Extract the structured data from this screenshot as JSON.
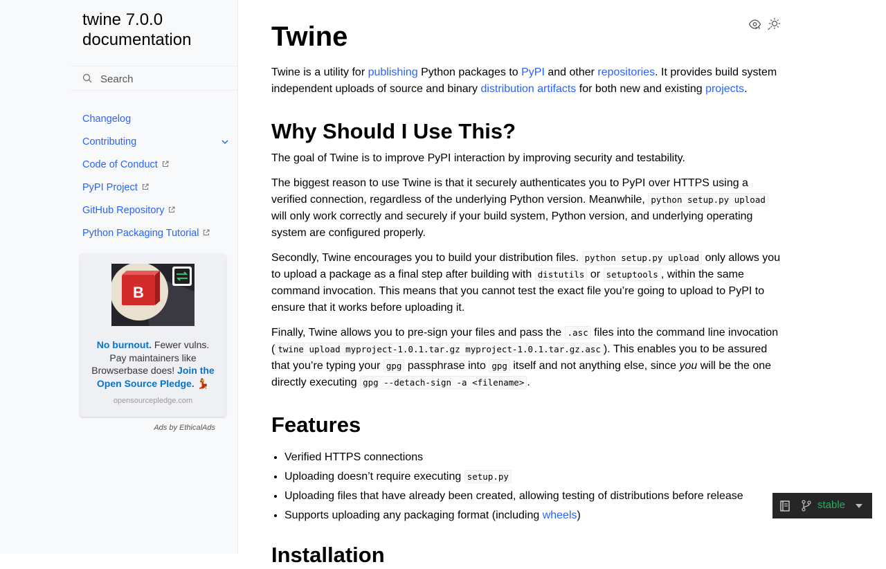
{
  "sidebar": {
    "brand_line1": "twine 7.0.0",
    "brand_line2": "documentation",
    "search_placeholder": "Search",
    "items": [
      {
        "label": "Changelog"
      },
      {
        "label": "Contributing"
      },
      {
        "label": "Code of Conduct"
      },
      {
        "label": "PyPI Project"
      },
      {
        "label": "GitHub Repository"
      },
      {
        "label": "Python Packaging Tutorial"
      }
    ],
    "ad": {
      "logo_letter": "B",
      "bold1": "No burnout.",
      "text1": " Fewer vulns. Pay maintainers like Browserbase does! ",
      "bold2": "Join the Open Source Pledge.",
      "emoji": " 💃",
      "domain": "opensourcepledge.com",
      "ads_by": "Ads by EthicalAds"
    }
  },
  "content": {
    "title": "Twine",
    "intro": {
      "t1": "Twine is a utility for ",
      "l1": "publishing",
      "t2": " Python packages to ",
      "l2": "PyPI",
      "t3": " and other ",
      "l3": "repositories",
      "t4": ". It provides build system independent uploads of source and binary ",
      "l4": "distribution artifacts",
      "t5": " for both new and existing ",
      "l5": "projects",
      "t6": "."
    },
    "h_why": "Why Should I Use This?",
    "p_goal": "The goal of Twine is to improve PyPI interaction by improving security and testability.",
    "p_reason": {
      "t1": "The biggest reason to use Twine is that it securely authenticates you to PyPI over HTTPS using a verified connection, regardless of the underlying Python version. Meanwhile, ",
      "c1": "python setup.py upload",
      "t2": " will only work correctly and securely if your build system, Python version, and underlying operating system are configured properly."
    },
    "p_second": {
      "t1": "Secondly, Twine encourages you to build your distribution files. ",
      "c1": "python setup.py upload",
      "t2": " only allows you to upload a package as a final step after building with ",
      "c2": "distutils",
      "t3": " or ",
      "c3": "setuptools",
      "t4": ", within the same command invocation. This means that you cannot test the exact file you’re going to upload to PyPI to ensure that it works before uploading it."
    },
    "p_final": {
      "t1": "Finally, Twine allows you to pre-sign your files and pass the ",
      "c1": ".asc",
      "t2": " files into the command line invocation (",
      "c2": "twine upload myproject-1.0.1.tar.gz myproject-1.0.1.tar.gz.asc",
      "t3": "). This enables you to be assured that you’re typing your ",
      "c3": "gpg",
      "t4": " passphrase into ",
      "c4": "gpg",
      "t5": " itself and not anything else, since ",
      "em": "you",
      "t6": " will be the one directly executing ",
      "c5": "gpg --detach-sign -a <filename>",
      "t7": "."
    },
    "h_features": "Features",
    "features": {
      "f1": "Verified HTTPS connections",
      "f2_text": "Uploading doesn’t require executing ",
      "f2_code": "setup.py",
      "f3": "Uploading files that have already been created, allowing testing of distributions before release",
      "f4_text": "Supports uploading any packaging format (including ",
      "f4_link": "wheels",
      "f4_end": ")"
    },
    "h_install": "Installation"
  },
  "rtd": {
    "version": "stable",
    "accent": "#27ae60"
  },
  "colors": {
    "link": "#2962ff",
    "sidebar_bg": "#f8f9fb",
    "rtd_bg": "#272525"
  }
}
